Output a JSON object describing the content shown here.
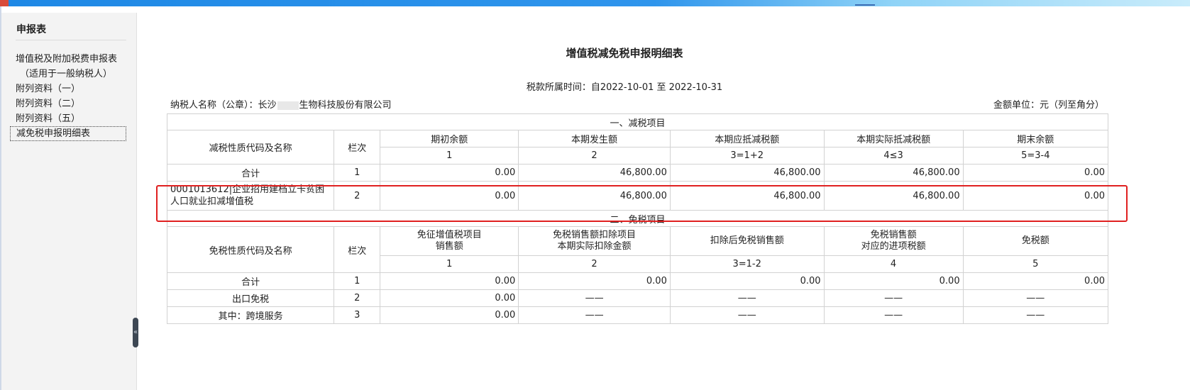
{
  "sidebar": {
    "title": "申报表",
    "items": [
      {
        "label": "增值税及附加税费申报表",
        "sub": "（适用于一般纳税人）"
      },
      {
        "label": "附列资料（一）"
      },
      {
        "label": "附列资料（二）"
      },
      {
        "label": "附列资料（五）"
      },
      {
        "label": "减免税申报明细表",
        "active": true
      }
    ],
    "collapse_glyph": "«"
  },
  "report": {
    "title": "增值税减免税申报明细表",
    "period": "税款所属时间：自2022-10-01 至 2022-10-31",
    "taxpayer_label": "纳税人名称（公章）：",
    "taxpayer_name_start": "长沙",
    "taxpayer_name_end": "生物科技股份有限公司",
    "unit": "金额单位：元（列至角分）"
  },
  "reduction": {
    "section_title": "一、减税项目",
    "name_header": "减税性质代码及名称",
    "line_header": "栏次",
    "columns": [
      "期初余额",
      "本期发生额",
      "本期应抵减税额",
      "本期实际抵减税额",
      "期末余额"
    ],
    "column_codes": [
      "1",
      "2",
      "3=1+2",
      "4≤3",
      "5=3-4"
    ],
    "rows": [
      {
        "name": "合计",
        "line": "1",
        "values": [
          "0.00",
          "46,800.00",
          "46,800.00",
          "46,800.00",
          "0.00"
        ]
      },
      {
        "name": "0001013612|企业招用建档立卡贫困人口就业扣减增值税",
        "line": "2",
        "values": [
          "0.00",
          "46,800.00",
          "46,800.00",
          "46,800.00",
          "0.00"
        ]
      }
    ]
  },
  "exemption": {
    "section_title": "二、免税项目",
    "name_header": "免税性质代码及名称",
    "line_header": "栏次",
    "columns": [
      {
        "line1": "免征增值税项目",
        "line2": "销售额"
      },
      {
        "line1": "免税销售额扣除项目",
        "line2": "本期实际扣除金额"
      },
      {
        "line1": "扣除后免税销售额",
        "line2": ""
      },
      {
        "line1": "免税销售额",
        "line2": "对应的进项税额"
      },
      {
        "line1": "免税额",
        "line2": ""
      }
    ],
    "column_codes": [
      "1",
      "2",
      "3=1-2",
      "4",
      "5"
    ],
    "rows": [
      {
        "name": "合计",
        "line": "1",
        "values": [
          "0.00",
          "0.00",
          "0.00",
          "0.00",
          "0.00"
        ]
      },
      {
        "name": "出口免税",
        "line": "2",
        "values": [
          "0.00",
          "——",
          "——",
          "——",
          "——"
        ]
      },
      {
        "name": "其中：跨境服务",
        "line": "3",
        "values": [
          "0.00",
          "——",
          "——",
          "——",
          "——"
        ]
      }
    ]
  },
  "colors": {
    "highlight_border": "#e02020",
    "grid_line": "#d2d2d2",
    "sidebar_bg": "#f3f3f3"
  }
}
